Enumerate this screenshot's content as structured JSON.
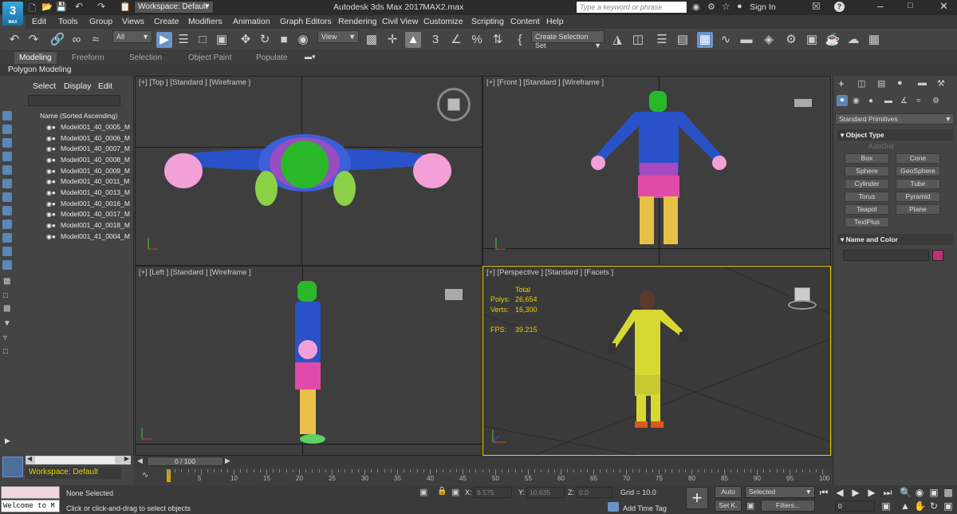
{
  "titlebar": {
    "app_title": "Autodesk 3ds Max 2017",
    "file_name": "MAX2.max",
    "workspace": "Workspace: Default",
    "search_placeholder": "Type a keyword or phrase",
    "sign_in": "Sign In"
  },
  "logo": {
    "main": "3",
    "sub": "MAX"
  },
  "menu": [
    "Edit",
    "Tools",
    "Group",
    "Views",
    "Create",
    "Modifiers",
    "Animation",
    "Graph Editors",
    "Rendering",
    "Civil View",
    "Customize",
    "Scripting",
    "Content",
    "Help"
  ],
  "toolbar": {
    "selection_filter": "All",
    "coordinate_system": "View",
    "named_selection_set": "Create Selection Set"
  },
  "ribbon": {
    "tabs": [
      "Modeling",
      "Freeform",
      "Selection",
      "Object Paint",
      "Populate"
    ],
    "panel_label": "Polygon Modeling"
  },
  "scene_explorer": {
    "tabs": [
      "Select",
      "Display",
      "Edit"
    ],
    "column_header": "Name (Sorted Ascending)",
    "items": [
      "Model001_40_0005_M",
      "Model001_40_0006_M",
      "Model001_40_0007_M",
      "Model001_40_0008_M",
      "Model001_40_0009_M",
      "Model001_40_0011_M",
      "Model001_40_0013_M",
      "Model001_40_0016_M",
      "Model001_40_0017_M",
      "Model001_40_0018_M",
      "Model001_41_0004_M"
    ],
    "workspace_footer": "Workspace: Default"
  },
  "viewports": {
    "top": "[+] [Top ] [Standard ] [Wireframe ]",
    "front": "[+] [Front ] [Standard ] [Wireframe ]",
    "left": "[+] [Left ] [Standard ] [Wireframe ]",
    "perspective": "[+] [Perspective ] [Standard ] [Facets ]"
  },
  "stats": {
    "total_label": "Total",
    "polys_label": "Polys:",
    "polys_value": "26,654",
    "verts_label": "Verts:",
    "verts_value": "16,300",
    "fps_label": "FPS:",
    "fps_value": "39.215"
  },
  "command_panel": {
    "category": "Standard Primitives",
    "object_type_title": "Object Type",
    "autogrid": "AutoGrid",
    "primitives": [
      "Box",
      "Cone",
      "Sphere",
      "GeoSphere",
      "Cylinder",
      "Tube",
      "Torus",
      "Pyramid",
      "Teapot",
      "Plane",
      "TextPlus"
    ],
    "name_and_color_title": "Name and Color",
    "object_color": "#c0307a"
  },
  "timeline": {
    "frame_counter": "0 / 100",
    "ticks": [
      "0",
      "5",
      "10",
      "15",
      "20",
      "25",
      "30",
      "35",
      "40",
      "45",
      "50",
      "55",
      "60",
      "65",
      "70",
      "75",
      "80",
      "85",
      "90",
      "95",
      "100"
    ]
  },
  "status": {
    "maxscript": "Welcome to M",
    "selection_status": "None Selected",
    "prompt": "Click or click-and-drag to select objects",
    "x_label": "X:",
    "x_value": "6.575",
    "y_label": "Y:",
    "y_value": "10.635",
    "z_label": "Z:",
    "z_value": "0.0",
    "grid": "Grid = 10.0",
    "add_time_tag": "Add Time Tag",
    "auto_key": "Auto",
    "set_key": "Set K.",
    "key_filter": "Selected",
    "filters": "Filters...",
    "current_frame": "0"
  }
}
